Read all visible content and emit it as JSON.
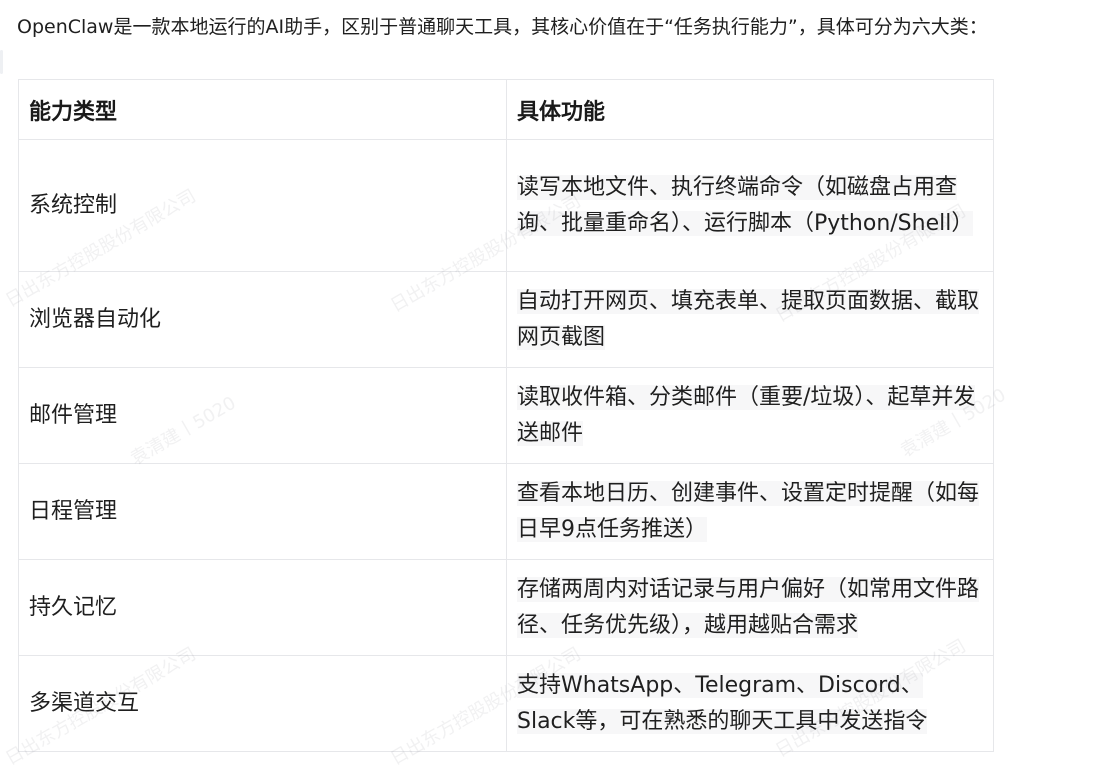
{
  "intro": "OpenClaw是一款本地运行的AI助手，区别于普通聊天工具，其核心价值在于“任务执行能力”，具体可分为六大类：",
  "table": {
    "headers": [
      "能力类型",
      "具体功能"
    ],
    "rows": [
      {
        "type": "系统控制",
        "function": "读写本地文件、执行终端命令（如磁盘占用查询、批量重命名）、运行脚本（Python/Shell）"
      },
      {
        "type": "浏览器自动化",
        "function": "自动打开网页、填充表单、提取页面数据、截取网页截图"
      },
      {
        "type": "邮件管理",
        "function": "读取收件箱、分类邮件（重要/垃圾）、起草并发送邮件"
      },
      {
        "type": "日程管理",
        "function": "查看本地日历、创建事件、设置定时提醒（如每日早9点任务推送）"
      },
      {
        "type": "持久记忆",
        "function": "存储两周内对话记录与用户偏好（如常用文件路径、任务优先级），越用越贴合需求"
      },
      {
        "type": "多渠道交互",
        "function": "支持WhatsApp、Telegram、Discord、Slack等，可在熟悉的聊天工具中发送指令"
      }
    ]
  },
  "watermark": {
    "company": "日出东方控股股份有限公司",
    "person": "袁清建丨5020"
  }
}
